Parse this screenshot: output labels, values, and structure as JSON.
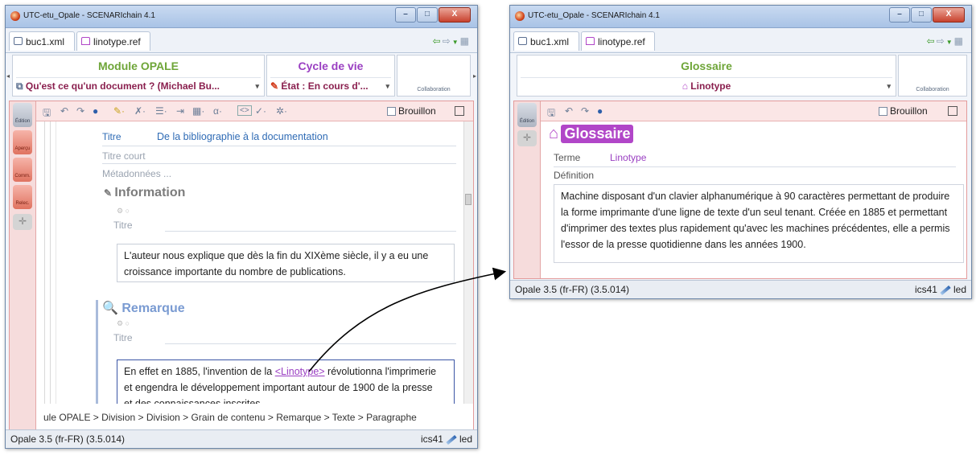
{
  "left_window": {
    "title": "UTC-etu_Opale - SCENARIchain 4.1",
    "window_buttons": {
      "minimize": "–",
      "maximize": "□",
      "close": "X"
    },
    "tabs": [
      {
        "label": "buc1.xml"
      },
      {
        "label": "linotype.ref"
      }
    ],
    "header": {
      "module_title": "Module OPALE",
      "module_combo": "Qu'est ce qu'un document ? (Michael Bu...",
      "lifecycle_title": "Cycle de vie",
      "lifecycle_combo": "État : En cours d'...",
      "collaboration_label": "Collaboration"
    },
    "toolbar": {
      "brouillon_label": "Brouillon",
      "alpha_label": "α"
    },
    "sidebar": [
      "Édition",
      "Aperçu",
      "Comm.",
      "Relec."
    ],
    "editor": {
      "titre_label": "Titre",
      "titre_value": "De la bibliographie à la documentation",
      "titre_court_label": "Titre court",
      "metadonnees_label": "Métadonnées ...",
      "information_heading": "Information",
      "info_titre_label": "Titre",
      "info_text_line1": "L'auteur nous explique que dès la fin du XIXème siècle, il y a eu une",
      "info_text_line2": "croissance importante du nombre de publications.",
      "remarque_heading": "Remarque",
      "rem_titre_label": "Titre",
      "rem_text_line1_before": "En effet en 1885, l'invention de la ",
      "rem_text_link": "<Linotype>",
      "rem_text_line1_after": " révolutionna l'imprimerie",
      "rem_text_line2": "et engendra le développement important autour de 1900 de la presse",
      "rem_text_line3": "et des connaissances inscrites."
    },
    "breadcrumb": "ule OPALE > Division > Division > Grain de contenu > Remarque > Texte > Paragraphe",
    "status_left": "Opale 3.5 (fr-FR) (3.5.014)",
    "status_user": "ics41",
    "status_right": "led"
  },
  "right_window": {
    "title": "UTC-etu_Opale - SCENARIchain 4.1",
    "window_buttons": {
      "minimize": "–",
      "maximize": "□",
      "close": "X"
    },
    "tabs": [
      {
        "label": "buc1.xml"
      },
      {
        "label": "linotype.ref"
      }
    ],
    "header": {
      "glossaire_title": "Glossaire",
      "linotype_combo": "Linotype",
      "collaboration_label": "Collaboration"
    },
    "toolbar": {
      "brouillon_label": "Brouillon"
    },
    "sidebar": [
      "Édition"
    ],
    "editor": {
      "heading": "Glossaire",
      "terme_label": "Terme",
      "terme_value": "Linotype",
      "definition_label": "Définition",
      "definition_line1": "Machine disposant d'un clavier alphanumérique à 90 caractères permettant de produire",
      "definition_line2": "la forme imprimante d'une ligne de texte d'un seul tenant. Créée en 1885 et permettant",
      "definition_line3": "d'imprimer des textes plus rapidement qu'avec les machines précédentes, elle a permis",
      "definition_line4": "l'essor de la presse quotidienne dans les années 1900."
    },
    "status_left": "Opale 3.5 (fr-FR) (3.5.014)",
    "status_user": "ics41",
    "status_right": "led"
  },
  "colors": {
    "module_green": "#6ea538",
    "lifecycle_violet": "#9a3fc2",
    "glossaire_badge": "#b146c8",
    "link_violet": "#9a3fc2",
    "panel_border": "#e39b9b"
  }
}
